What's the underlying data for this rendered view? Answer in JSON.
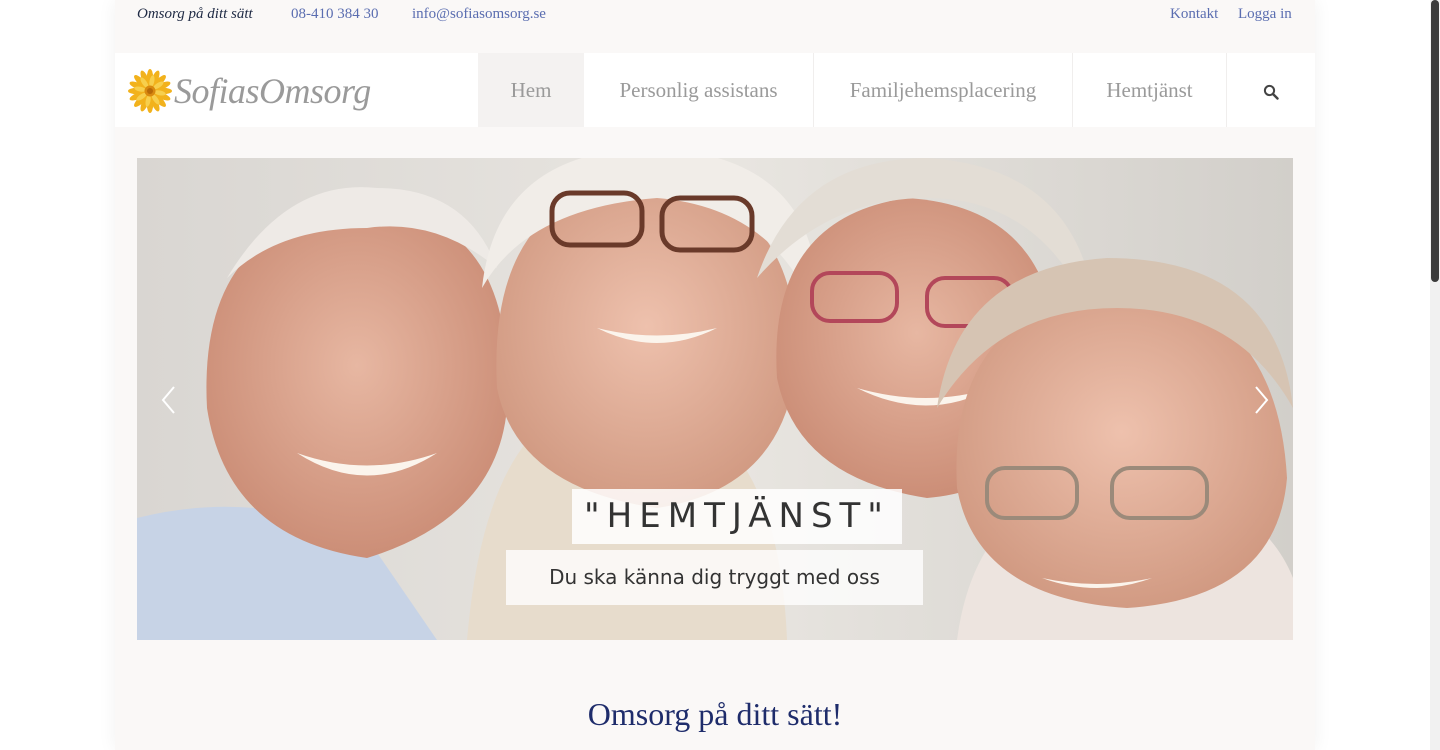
{
  "topbar": {
    "tagline": "Omsorg på ditt sätt",
    "phone": "08-410 384 30",
    "email": "info@sofiasomsorg.se",
    "contact": "Kontakt",
    "login": "Logga in"
  },
  "logo": {
    "text": "SofiasOmsorg"
  },
  "nav": {
    "items": [
      {
        "label": "Hem"
      },
      {
        "label": "Personlig assistans"
      },
      {
        "label": "Familjehemsplacering"
      },
      {
        "label": "Hemtjänst"
      }
    ],
    "search_icon": "search-icon"
  },
  "slider": {
    "caption_title": "\"HEMTJÄNST\"",
    "caption_subtitle": "Du ska känna dig tryggt med oss",
    "prev_icon": "chevron-left-icon",
    "next_icon": "chevron-right-icon"
  },
  "main": {
    "heading": "Omsorg på ditt sätt!"
  },
  "colors": {
    "link": "#5a6db0",
    "heading": "#1e2c6b",
    "nav_text": "#9a9a9a",
    "page_bg": "#faf8f7"
  }
}
